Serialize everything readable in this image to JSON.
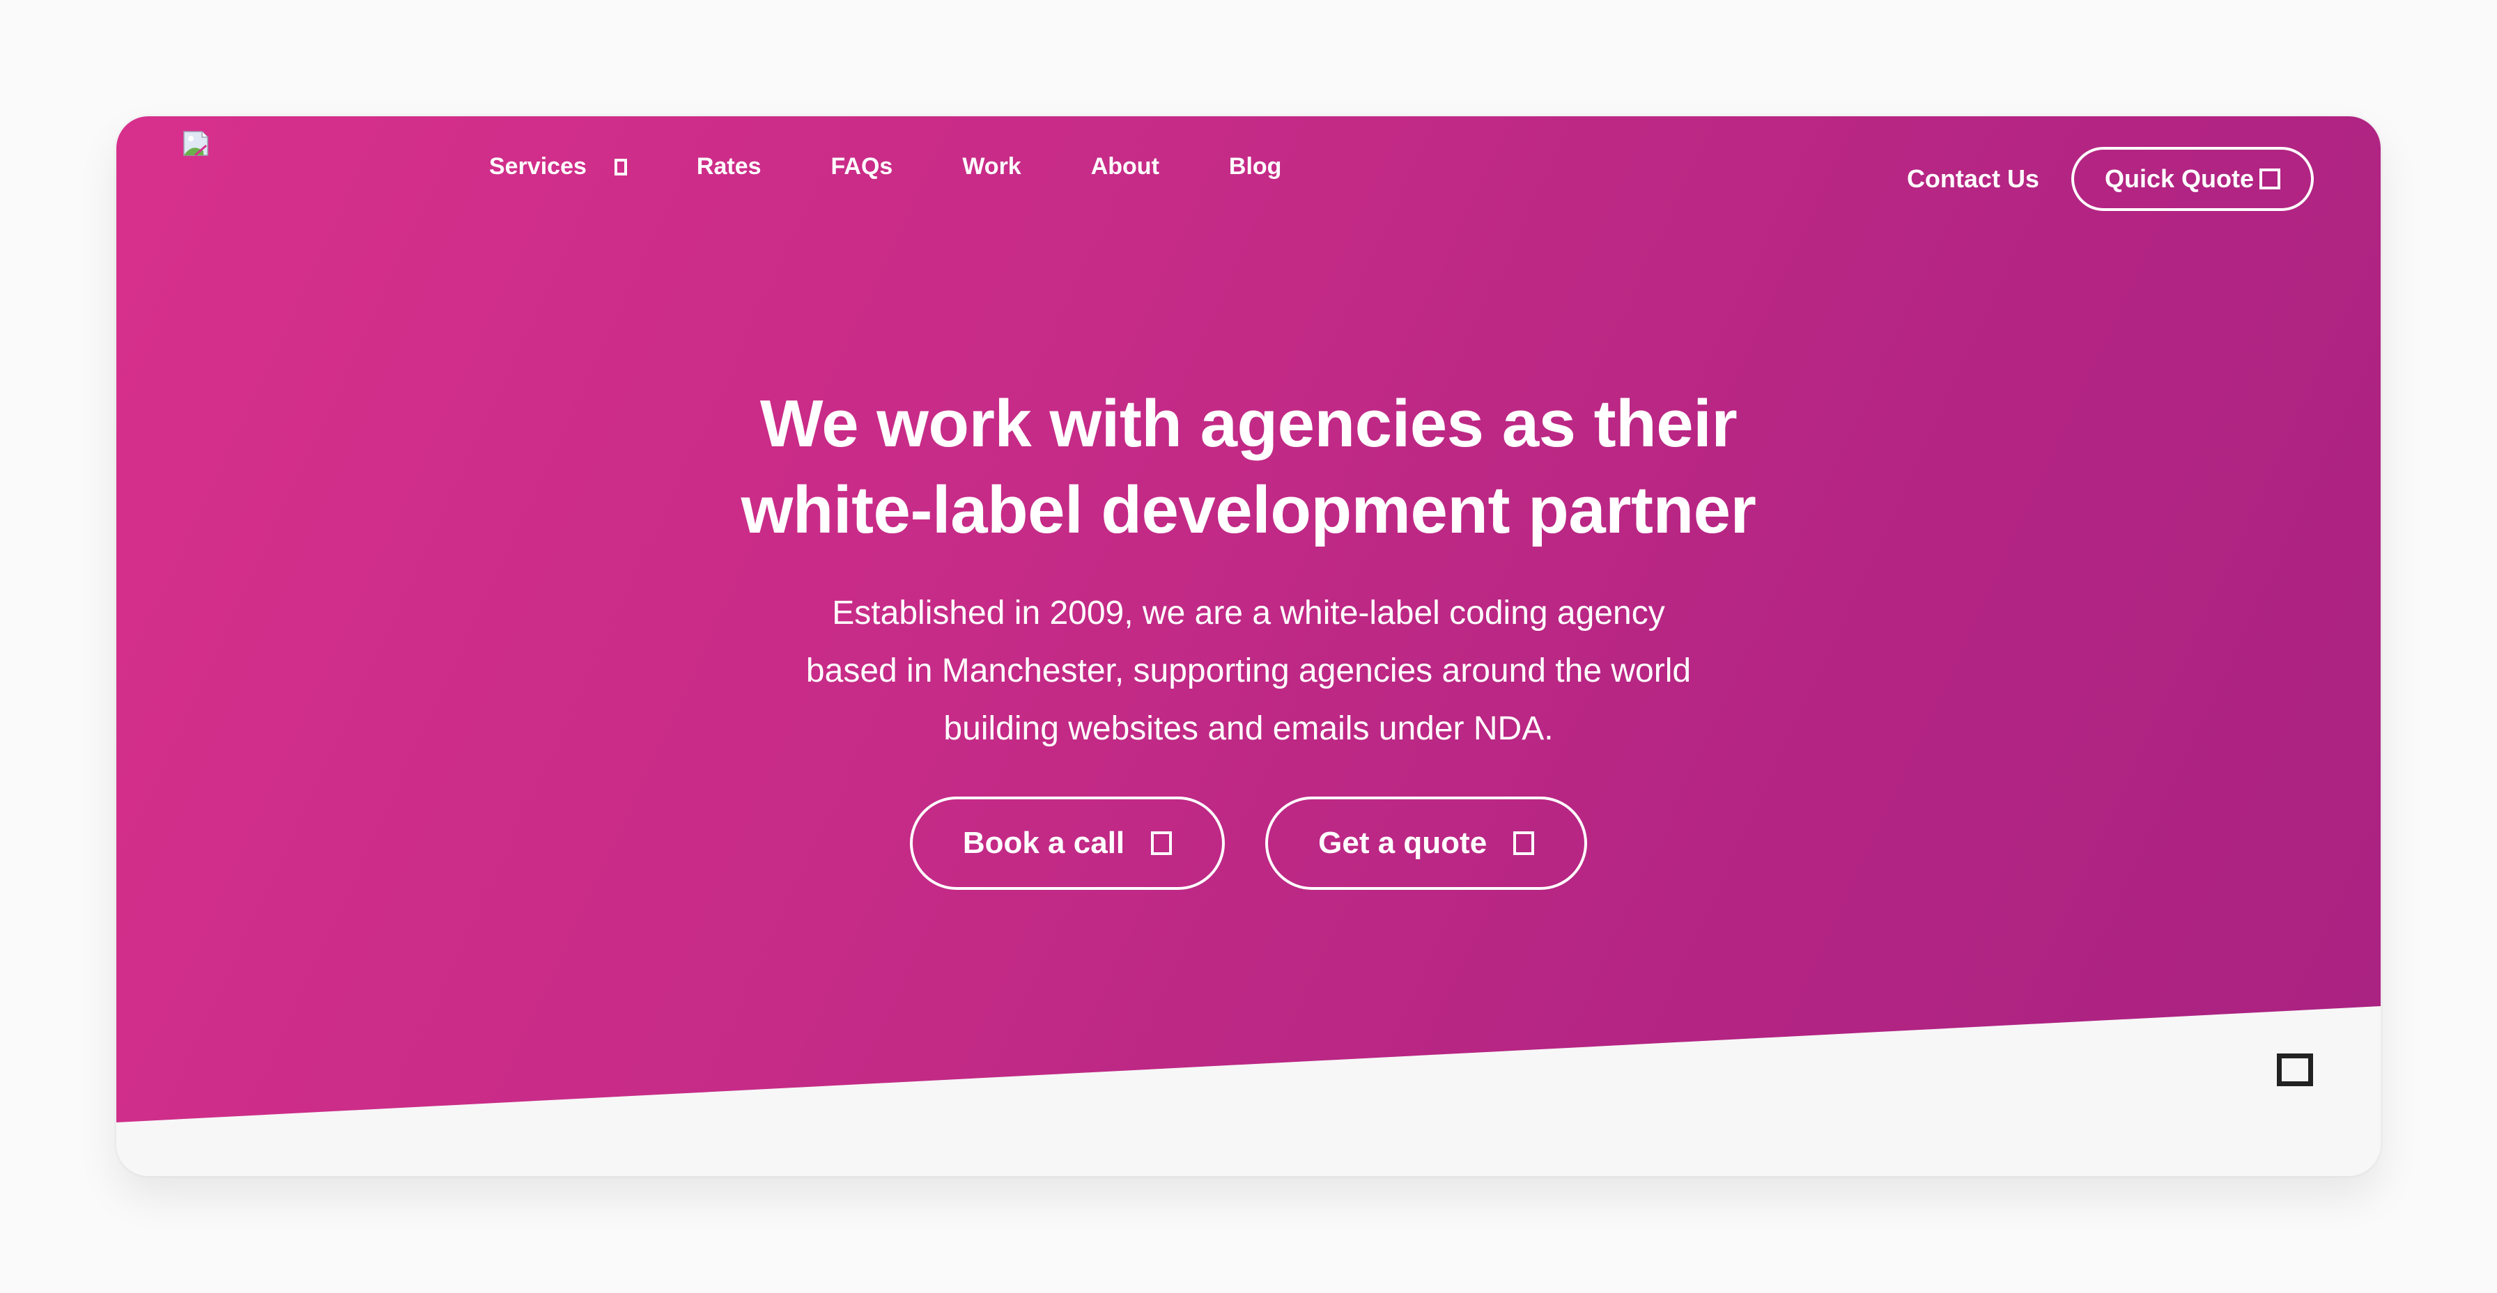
{
  "header": {
    "logo_alt": "logo",
    "nav": [
      {
        "label": "Services",
        "icon": "dropdown-icon"
      },
      {
        "label": "Rates"
      },
      {
        "label": "FAQs"
      },
      {
        "label": "Work"
      },
      {
        "label": "About"
      },
      {
        "label": "Blog"
      }
    ],
    "contact_label": "Contact Us",
    "quick_quote_label": "Quick Quote",
    "quick_quote_icon": "arrow-icon"
  },
  "hero": {
    "headline_line1": "We work with agencies as their",
    "headline_line2": "white-label development partner",
    "subtext_line1": "Established in 2009, we are a white-label coding agency",
    "subtext_line2": "based in Manchester, supporting agencies around the world",
    "subtext_line3": "building websites and emails under NDA.",
    "cta_primary": {
      "label": "Book a call",
      "icon": "arrow-icon"
    },
    "cta_secondary": {
      "label": "Get a quote",
      "icon": "arrow-icon"
    }
  },
  "floating_widget": {
    "icon": "chat-icon"
  },
  "colors": {
    "gradient_start": "#d7308c",
    "gradient_end": "#a92282",
    "text": "#ffffff",
    "page_bg": "#fafafa"
  }
}
